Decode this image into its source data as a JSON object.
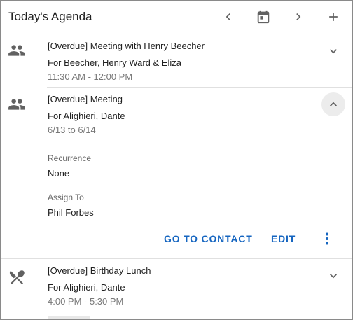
{
  "header": {
    "title": "Today's Agenda",
    "prev_icon": "chevron-left-icon",
    "calendar_icon": "calendar-icon",
    "next_icon": "chevron-right-icon",
    "add_icon": "plus-icon"
  },
  "items": [
    {
      "icon": "people-icon",
      "title": "[Overdue] Meeting with Henry Beecher",
      "for": "For Beecher, Henry Ward & Eliza",
      "time": "11:30 AM - 12:00 PM",
      "expanded": false
    },
    {
      "icon": "people-icon",
      "title": "[Overdue] Meeting",
      "for": "For Alighieri, Dante",
      "time": "6/13 to 6/14",
      "expanded": true,
      "details": {
        "recurrence_label": "Recurrence",
        "recurrence_value": "None",
        "assign_label": "Assign To",
        "assign_value": "Phil Forbes"
      },
      "actions": {
        "go_to_contact": "GO TO CONTACT",
        "edit": "EDIT"
      }
    },
    {
      "icon": "fork-knife-icon",
      "title": "[Overdue] Birthday Lunch",
      "for": "For Alighieri, Dante",
      "time": "4:00 PM - 5:30 PM",
      "expanded": false
    }
  ],
  "colors": {
    "accent": "#1565c0",
    "icon": "#616161",
    "muted_text": "#777777"
  }
}
